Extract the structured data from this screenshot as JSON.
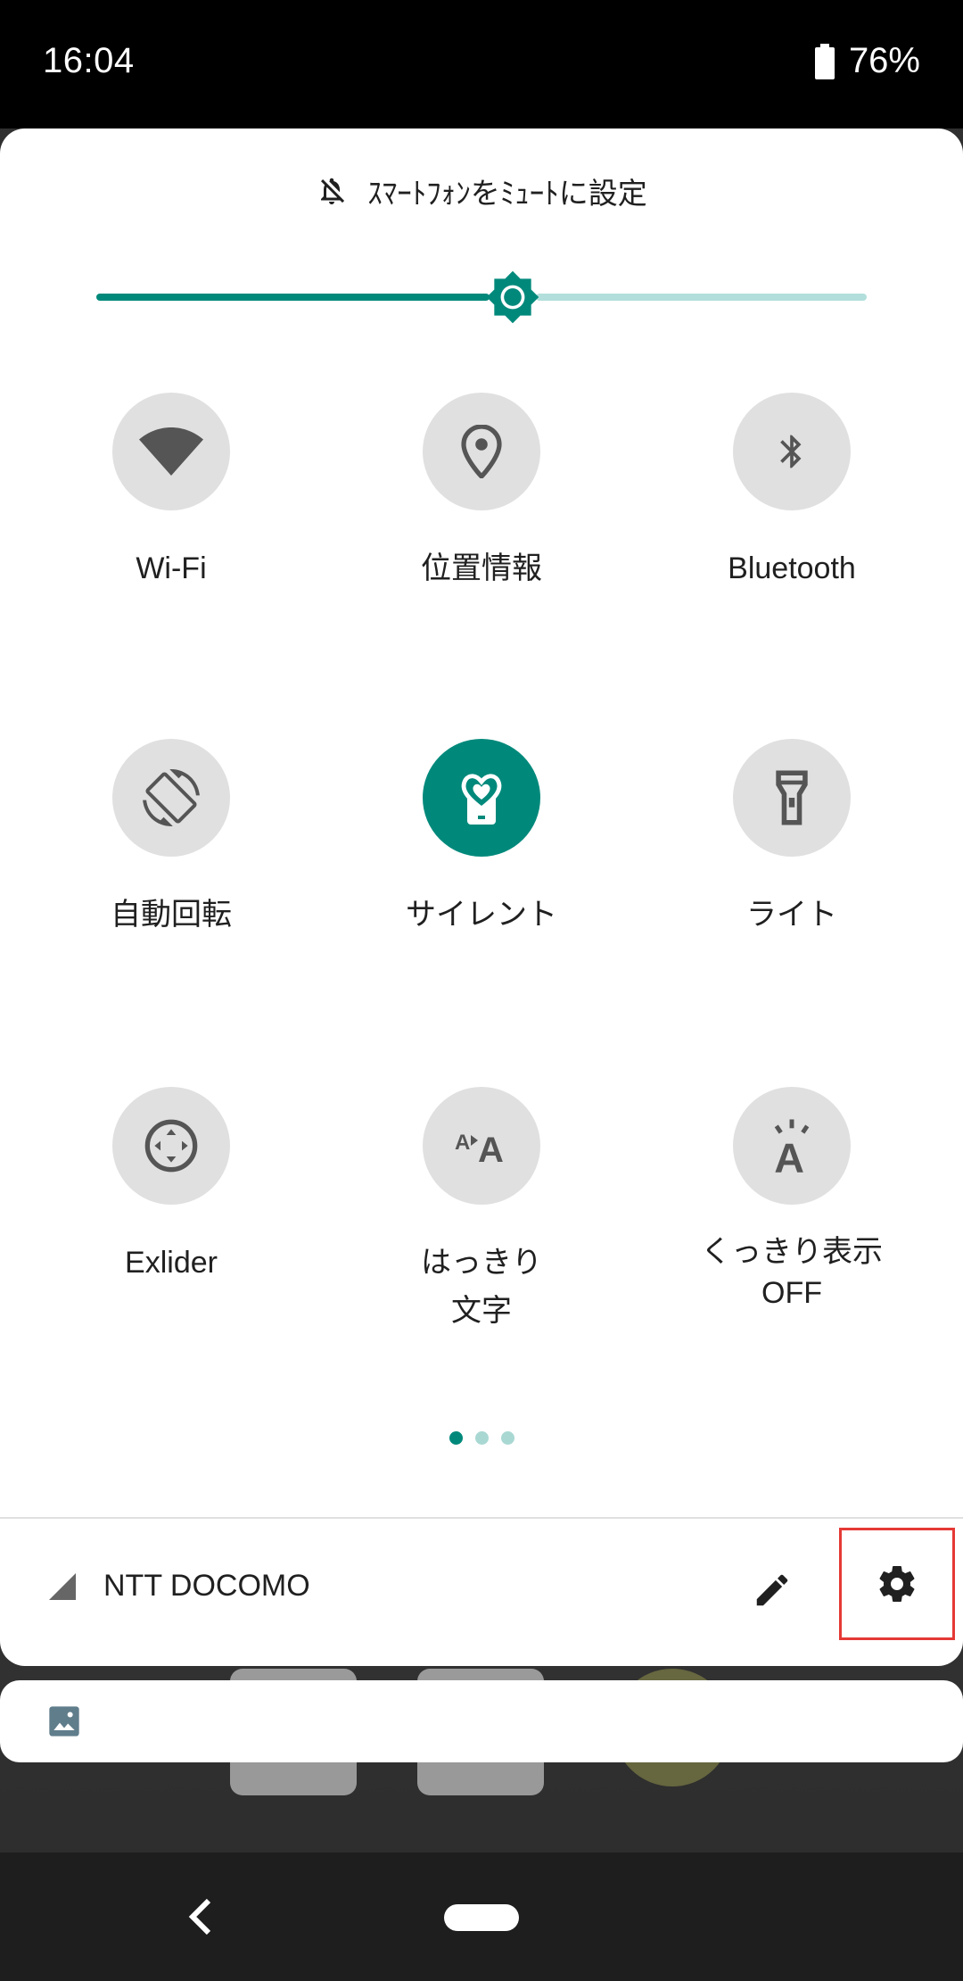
{
  "status_bar": {
    "time": "16:04",
    "battery": "76%"
  },
  "quick_settings": {
    "mute_label": "ｽﾏｰﾄﾌｫﾝをﾐｭｰﾄに設定",
    "brightness_level": 0.54,
    "tiles": [
      {
        "label": "Wi-Fi",
        "icon": "wifi-icon",
        "active": false
      },
      {
        "label": "位置情報",
        "icon": "location-icon",
        "active": false
      },
      {
        "label": "Bluetooth",
        "icon": "bluetooth-icon",
        "active": false
      },
      {
        "label": "自動回転",
        "icon": "auto-rotate-icon",
        "active": false
      },
      {
        "label": "サイレント",
        "icon": "silent-icon",
        "active": true
      },
      {
        "label": "ライト",
        "icon": "flashlight-icon",
        "active": false
      },
      {
        "label": "Exlider",
        "icon": "exlider-icon",
        "active": false
      },
      {
        "label_line1": "はっきり",
        "label_line2": "文字",
        "icon": "clear-text-icon",
        "active": false
      },
      {
        "label_line1": "くっきり表示",
        "label_line2": "OFF",
        "icon": "sharp-display-icon",
        "active": false
      }
    ],
    "page_dots": 3,
    "current_page": 0
  },
  "footer": {
    "carrier": "NTT DOCOMO",
    "edit_icon": "pencil-icon",
    "settings_icon": "gear-icon"
  },
  "colors": {
    "accent": "#00897b",
    "accent_light": "#b2dfdb",
    "tile_bg": "#e0e0e0",
    "highlight": "#e53935"
  }
}
